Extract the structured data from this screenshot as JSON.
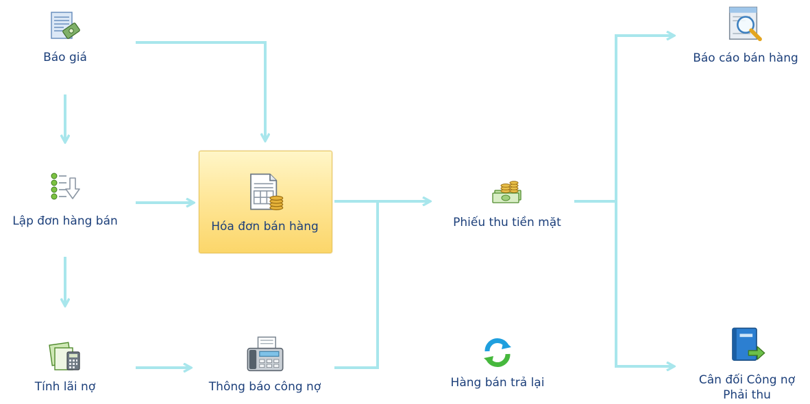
{
  "flowchart": {
    "arrow_color": "#a8e6ec",
    "label_color": "#1c3f7a",
    "highlight_color": "#ffe79a",
    "nodes": [
      {
        "id": "bao-gia",
        "label": "Báo giá",
        "icon": "quote-sheet-icon"
      },
      {
        "id": "lap-don-hang-ban",
        "label": "Lập đơn hàng bán",
        "icon": "order-list-icon"
      },
      {
        "id": "tinh-lai-no",
        "label": "Tính lãi nợ",
        "icon": "calculator-icon"
      },
      {
        "id": "hoa-don-ban-hang",
        "label": "Hóa đơn bán hàng",
        "icon": "invoice-coins-icon",
        "selected": true
      },
      {
        "id": "thong-bao-cong-no",
        "label": "Thông báo công nợ",
        "icon": "fax-icon"
      },
      {
        "id": "phieu-thu-tien-mat",
        "label": "Phiếu thu tiền mặt",
        "icon": "cash-coins-icon"
      },
      {
        "id": "hang-ban-tra-lai",
        "label": "Hàng bán trả lại",
        "icon": "refresh-icon"
      },
      {
        "id": "bao-cao-ban-hang",
        "label": "Báo cáo bán hàng",
        "icon": "report-magnifier-icon"
      },
      {
        "id": "can-doi-cong-no",
        "label": "Cân đối Công nợ Phải thu",
        "icon": "book-arrow-icon"
      }
    ]
  }
}
